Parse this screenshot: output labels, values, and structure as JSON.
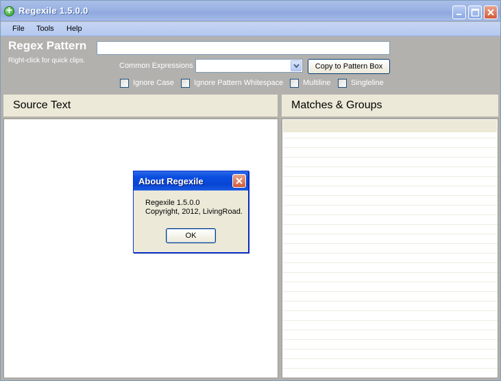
{
  "window": {
    "title": "Regexile 1.5.0.0",
    "icon": "plus-circle-icon"
  },
  "menu": {
    "file": "File",
    "tools": "Tools",
    "help": "Help"
  },
  "pattern": {
    "label": "Regex Pattern",
    "hint": "Right-click for quick clips.",
    "value": "",
    "common_label": "Common Expressions",
    "common_selected": "",
    "copy_button": "Copy to Pattern Box"
  },
  "options": [
    {
      "label": "Ignore Case",
      "checked": false
    },
    {
      "label": "Ignore Pattern Whitespace",
      "checked": false
    },
    {
      "label": "Multiline",
      "checked": false
    },
    {
      "label": "Singleline",
      "checked": false
    }
  ],
  "panels": {
    "source_title": "Source Text",
    "matches_title": "Matches & Groups"
  },
  "dialog": {
    "title": "About Regexile",
    "line1": "Regexile 1.5.0.0",
    "line2": "Copyright, 2012, LivingRoad.",
    "ok": "OK"
  },
  "colors": {
    "accent_blue": "#0a4de0",
    "panel_bg": "#ece9d8",
    "window_bg": "#b2b1ae"
  }
}
